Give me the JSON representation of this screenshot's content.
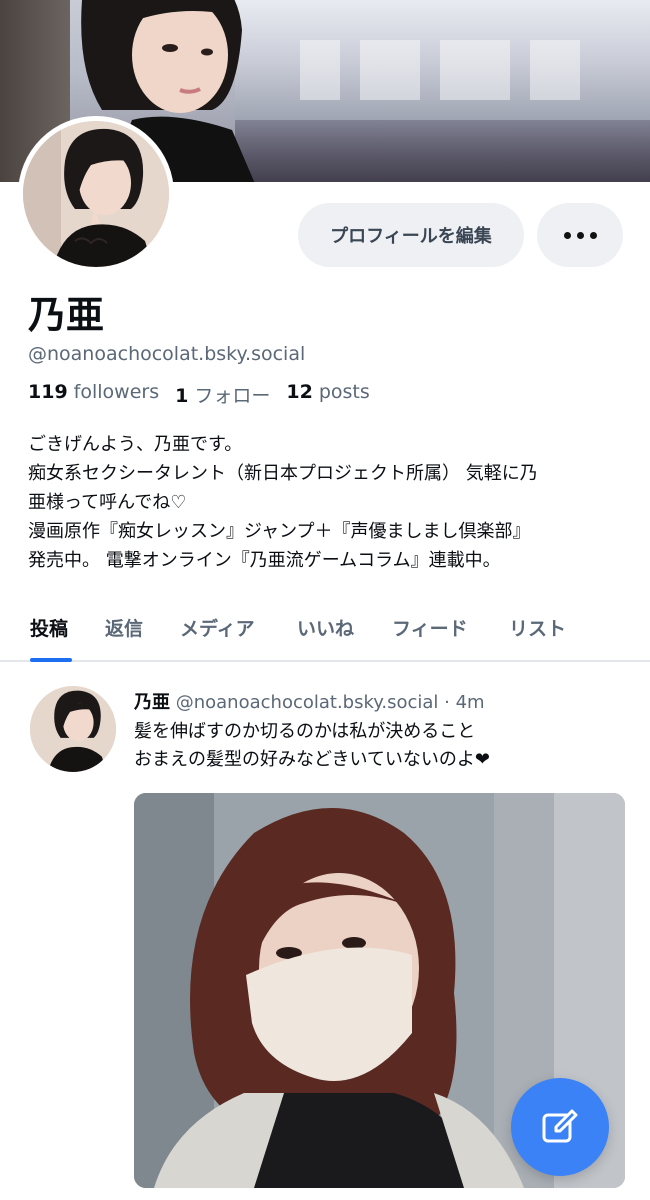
{
  "profile": {
    "display_name": "乃亜",
    "handle": "@noanoachocolat.bsky.social",
    "stats": {
      "followers_count": "119",
      "followers_label": "followers",
      "following_count": "1",
      "following_label": "フォロー",
      "posts_count": "12",
      "posts_label": "posts"
    },
    "bio": [
      "ごきげんよう、乃亜です。",
      "痴女系セクシータレント（新日本プロジェクト所属） 気軽に乃",
      "亜様って呼んでね♡",
      "漫画原作『痴女レッスン』ジャンプ＋『声優ましまし倶楽部』",
      "発売中。 電撃オンライン『乃亜流ゲームコラム』連載中。"
    ],
    "edit_profile_label": "プロフィールを編集"
  },
  "tabs": [
    {
      "label": "投稿",
      "active": true
    },
    {
      "label": "返信",
      "active": false
    },
    {
      "label": "メディア",
      "active": false
    },
    {
      "label": "いいね",
      "active": false
    },
    {
      "label": "フィード",
      "active": false
    },
    {
      "label": "リスト",
      "active": false
    }
  ],
  "post": {
    "author_name": "乃亜",
    "author_handle": "@noanoachocolat.bsky.social",
    "separator": "·",
    "time": "4m",
    "lines": [
      "髪を伸ばすのか切るのかは私が決めること",
      "おまえの髪型の好みなどきいていないのよ❤"
    ]
  },
  "colors": {
    "accent": "#1d6ff2",
    "compose_button": "#3a82f6",
    "muted_text": "#5b6877",
    "button_bg": "#eef0f4"
  },
  "icons": {
    "more": "more-horizontal-icon",
    "compose": "compose-icon"
  }
}
